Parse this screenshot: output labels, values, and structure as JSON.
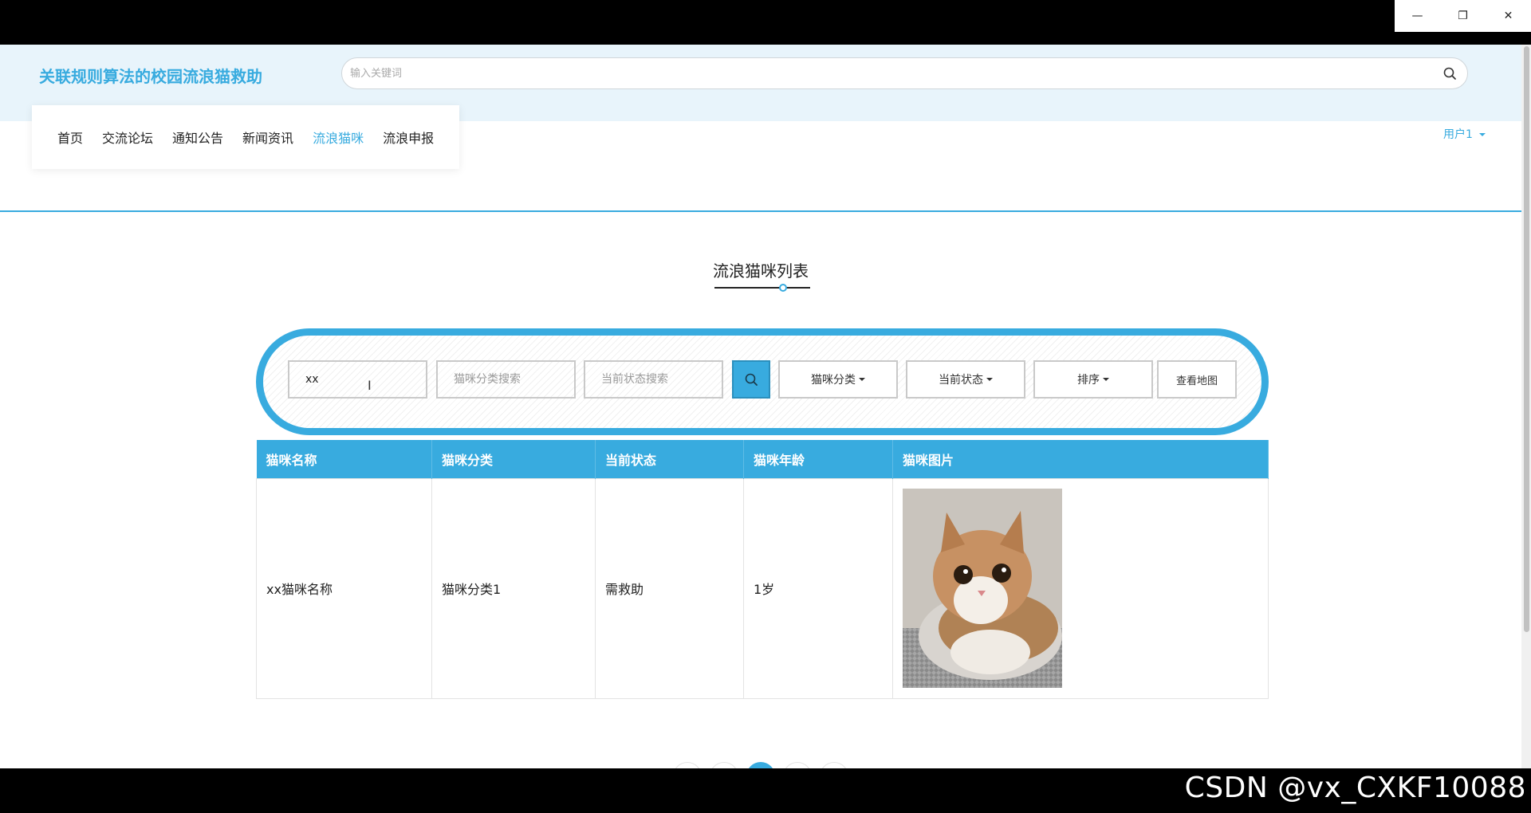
{
  "window": {
    "minimize_glyph": "—",
    "restore_glyph": "❐",
    "close_glyph": "✕"
  },
  "header": {
    "site_title": "关联规则算法的校园流浪猫救助",
    "search_placeholder": "输入关键词"
  },
  "nav": {
    "items": [
      {
        "label": "首页",
        "active": false
      },
      {
        "label": "交流论坛",
        "active": false
      },
      {
        "label": "通知公告",
        "active": false
      },
      {
        "label": "新闻资讯",
        "active": false
      },
      {
        "label": "流浪猫咪",
        "active": true
      },
      {
        "label": "流浪申报",
        "active": false
      }
    ],
    "user_label": "用户1"
  },
  "section": {
    "title": "流浪猫咪列表"
  },
  "search": {
    "name_value": "xx",
    "category_placeholder": "猫咪分类搜索",
    "status_placeholder": "当前状态搜索",
    "category_dropdown": "猫咪分类",
    "status_dropdown": "当前状态",
    "sort_dropdown": "排序",
    "map_button": "查看地图"
  },
  "table": {
    "headers": [
      "猫咪名称",
      "猫咪分类",
      "当前状态",
      "猫咪年龄",
      "猫咪图片"
    ],
    "rows": [
      {
        "name": "xx猫咪名称",
        "category": "猫咪分类1",
        "status": "需救助",
        "age": "1岁"
      }
    ]
  },
  "watermark": "CSDN @vx_CXKF10088",
  "colors": {
    "accent": "#38abdf",
    "header_bg": "#e8f4fb"
  }
}
